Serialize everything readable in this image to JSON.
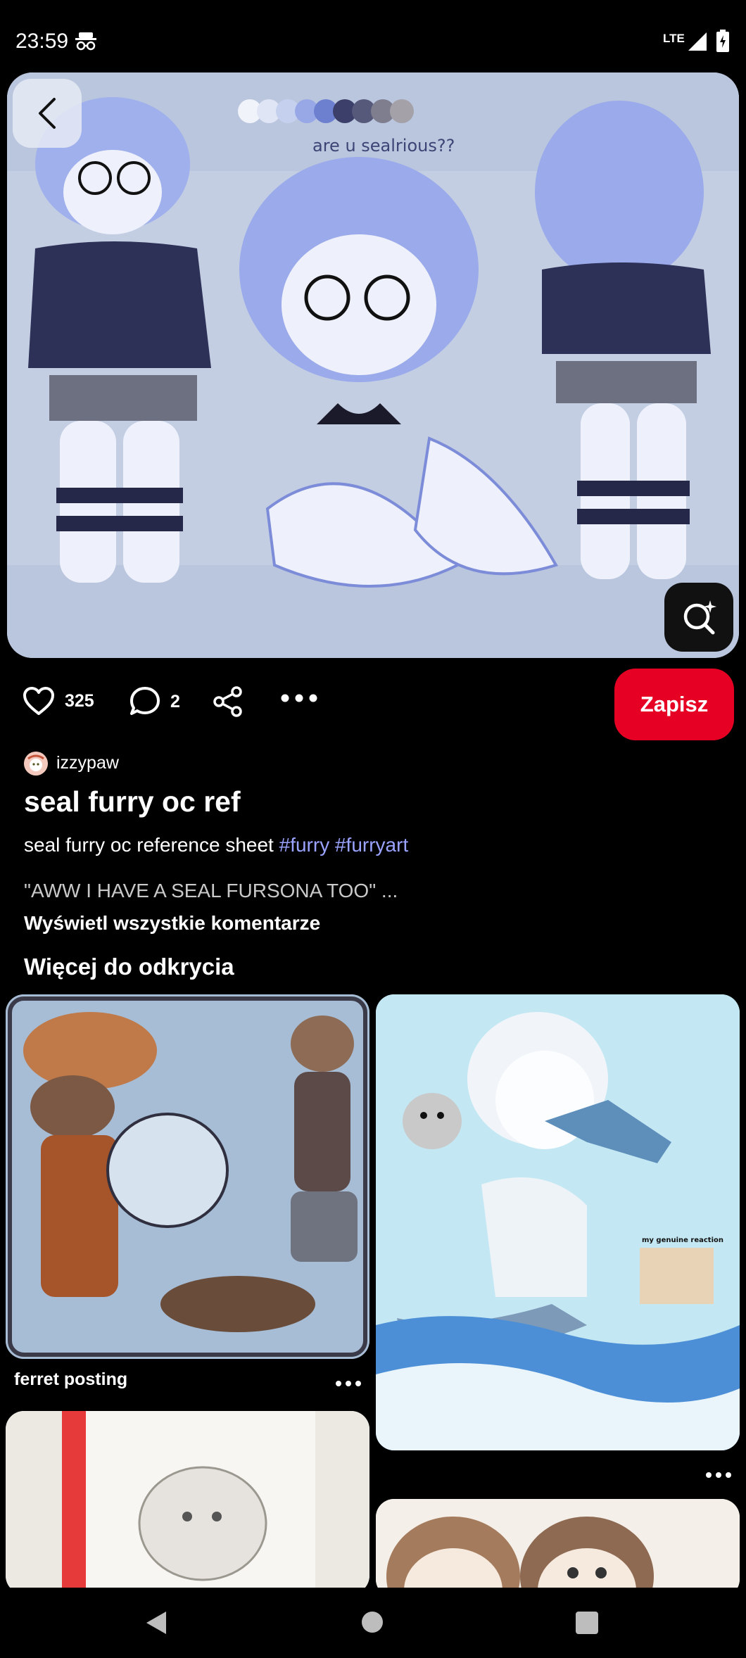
{
  "status_bar": {
    "time": "23:59",
    "network": "LTE",
    "icons": [
      "incognito-icon",
      "signal-icon",
      "battery-icon"
    ]
  },
  "pin": {
    "image_text": "are u sealrious??",
    "like_count": "325",
    "comment_count": "2",
    "save_label": "Zapisz",
    "author": "izzypaw",
    "title": "seal furry oc ref",
    "description_text": "seal furry oc reference sheet ",
    "hashtags": [
      "#furry",
      "#furryart"
    ],
    "comment_preview": "\"AWW I HAVE A SEAL FURSONA TOO\" ...",
    "view_all_comments": "Wyświetl wszystkie komentarze"
  },
  "more_section": {
    "heading": "Więcej do odkrycia",
    "cards": [
      {
        "caption": "ferret posting"
      },
      {
        "caption": ""
      },
      {
        "caption": ""
      },
      {
        "caption": ""
      }
    ],
    "seal_card_text": "my genuine reaction"
  },
  "colors": {
    "accent": "#e60023",
    "hashtag": "#9aa3ff",
    "background": "#000000"
  }
}
